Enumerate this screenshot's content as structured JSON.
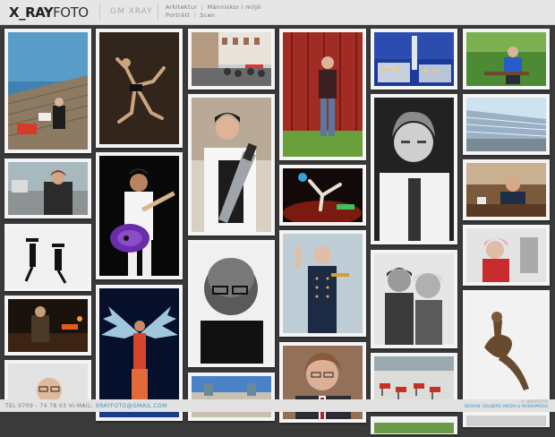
{
  "header": {
    "logo_bold": "X_RAY",
    "logo_light": "FOTO",
    "brand2": "GM XRAY",
    "nav_row1": [
      "Arkitektur",
      "Människor i miljö"
    ],
    "nav_row2": [
      "Porträtt",
      "Scen"
    ]
  },
  "photos": [
    {
      "subject": "man with laptop on wooden pier by water"
    },
    {
      "subject": "dancers sepia"
    },
    {
      "subject": "street café scene"
    },
    {
      "subject": "man leaning on red wall"
    },
    {
      "subject": "modern tower buildings at dusk"
    },
    {
      "subject": "man seated on park bench"
    },
    {
      "subject": "woman with chef knife"
    },
    {
      "subject": "breakdancer"
    },
    {
      "subject": "chef portrait black and white"
    },
    {
      "subject": "glass facade building"
    },
    {
      "subject": "woman at street"
    },
    {
      "subject": "guitarist with purple guitar"
    },
    {
      "subject": "man at table"
    },
    {
      "subject": "dancers with hats"
    },
    {
      "subject": "bald man with glasses black and white"
    },
    {
      "subject": "uniformed officer saluting"
    },
    {
      "subject": "two children black and white"
    },
    {
      "subject": "woman with pink hair"
    },
    {
      "subject": "stage performer"
    },
    {
      "subject": "dancer with feathered wings"
    },
    {
      "subject": "bronze sculpture"
    },
    {
      "subject": "man with glasses"
    },
    {
      "subject": "building with domes"
    },
    {
      "subject": "man with glasses and tie"
    },
    {
      "subject": "restaurant interior"
    }
  ],
  "footer": {
    "tel": "TEL 0709 - 74 78 03",
    "mail_label": "VI-MAIL:",
    "mail": "XRAYFOTO@GMAIL.COM",
    "right_line1": "© XRAYFOTO",
    "right_line2": "DESIGN: SOLBERG MEDIA & WORDPRESS"
  }
}
